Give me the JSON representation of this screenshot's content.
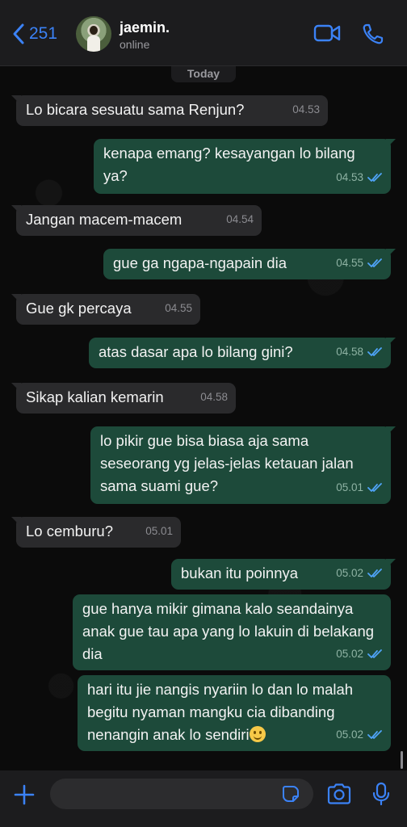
{
  "header": {
    "back_count": "251",
    "contact_name": "jaemin.",
    "status": "online"
  },
  "chat": {
    "date_label": "Today",
    "messages": [
      {
        "dir": "in",
        "text": "Lo bicara sesuatu sama Renjun?",
        "time": "04.53"
      },
      {
        "dir": "out",
        "text": "kenapa emang? kesayangan lo bilang ya?",
        "time": "04.53",
        "read": true
      },
      {
        "dir": "in",
        "text": "Jangan macem-macem",
        "time": "04.54"
      },
      {
        "dir": "out",
        "text": "gue ga ngapa-ngapain dia",
        "time": "04.55",
        "read": true
      },
      {
        "dir": "in",
        "text": "Gue gk percaya",
        "time": "04.55"
      },
      {
        "dir": "out",
        "text": "atas dasar apa lo bilang gini?",
        "time": "04.58",
        "read": true
      },
      {
        "dir": "in",
        "text": "Sikap kalian kemarin",
        "time": "04.58"
      },
      {
        "dir": "out",
        "text": "lo pikir gue bisa biasa aja sama seseorang yg jelas-jelas ketauan jalan sama suami gue?",
        "time": "05.01",
        "read": true
      },
      {
        "dir": "in",
        "text": "Lo cemburu?",
        "time": "05.01"
      },
      {
        "dir": "out",
        "text": "bukan itu poinnya",
        "time": "05.02",
        "read": true
      },
      {
        "dir": "out",
        "text": "gue hanya mikir gimana kalo seandainya anak gue tau apa yang lo lakuin di belakang dia",
        "time": "05.02",
        "read": true
      },
      {
        "dir": "out",
        "text": "hari itu jie nangis nyariin lo dan lo malah begitu nyaman mangku cia dibanding nenangin anak lo sendiri",
        "time": "05.02",
        "read": true,
        "emoji": "slightly-smiling-face"
      }
    ]
  },
  "composer": {
    "placeholder": ""
  },
  "colors": {
    "accent": "#3b82f6",
    "incoming_bubble": "#2a2a2c",
    "outgoing_bubble": "#1d4a3a",
    "read_ticks": "#4fa3f7"
  },
  "icons": {
    "back": "chevron-left-icon",
    "video": "video-camera-icon",
    "phone": "phone-icon",
    "plus": "plus-icon",
    "sticker": "sticker-icon",
    "camera": "camera-icon",
    "mic": "microphone-icon"
  }
}
